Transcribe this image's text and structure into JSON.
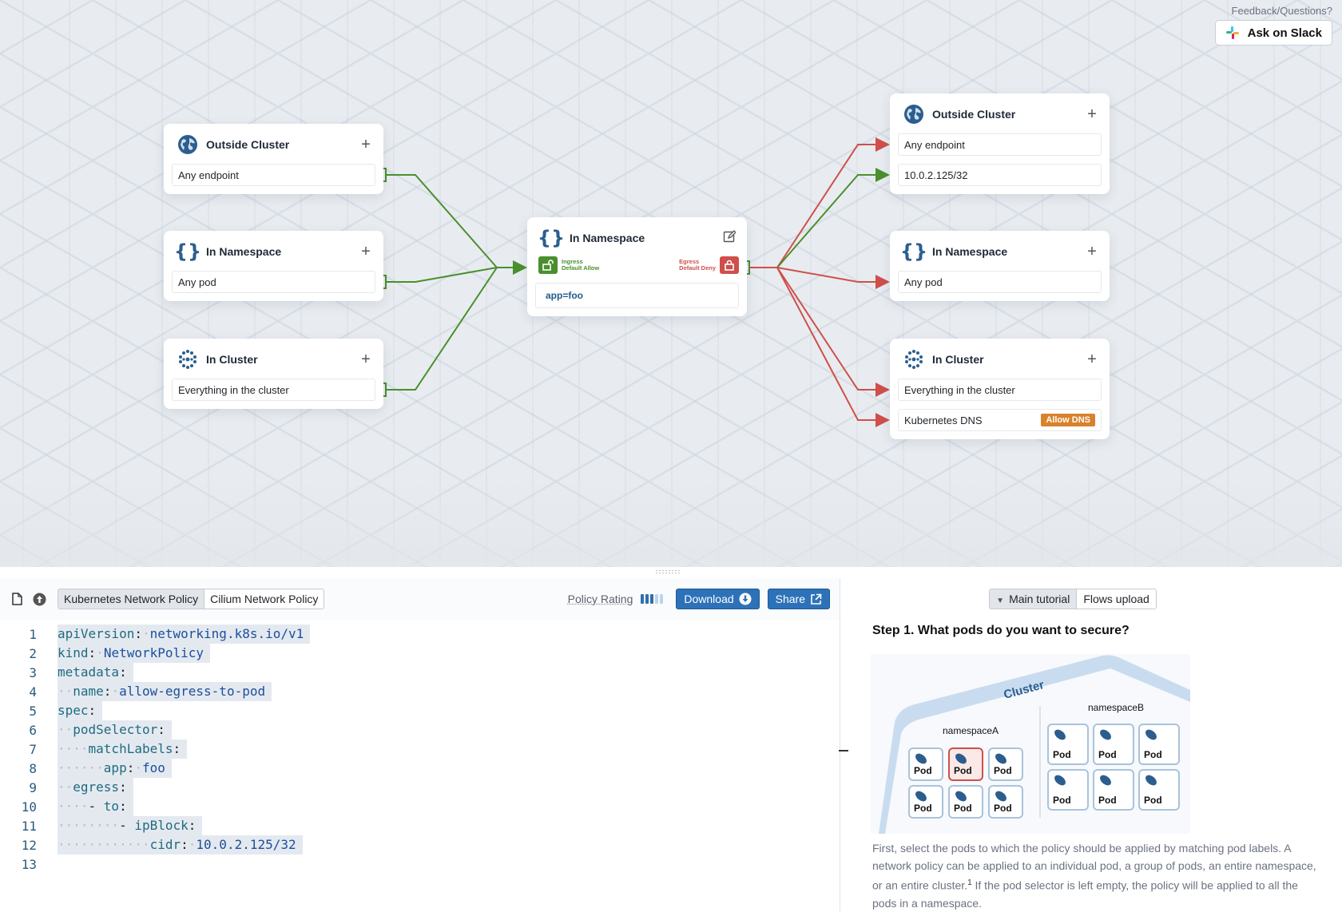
{
  "feedback": {
    "label": "Feedback/Questions?",
    "slack_button": "Ask on Slack"
  },
  "colors": {
    "allow": "#4a8f2e",
    "deny": "#cf4f4a",
    "brand": "#2d72b8",
    "dns_badge": "#d9822b"
  },
  "ingress": [
    {
      "title": "Outside Cluster",
      "icon": "globe-icon",
      "rows": [
        "Any endpoint"
      ]
    },
    {
      "title": "In Namespace",
      "icon": "braces-icon",
      "rows": [
        "Any pod"
      ]
    },
    {
      "title": "In Cluster",
      "icon": "cluster-icon",
      "rows": [
        "Everything in the cluster"
      ]
    }
  ],
  "center": {
    "title": "In Namespace",
    "ingress_label": "Ingress",
    "ingress_state": "Default Allow",
    "egress_label": "Egress",
    "egress_state": "Default Deny",
    "selector": "app=foo"
  },
  "egress": [
    {
      "title": "Outside Cluster",
      "icon": "globe-icon",
      "rows": [
        "Any endpoint",
        "10.0.2.125/32"
      ]
    },
    {
      "title": "In Namespace",
      "icon": "braces-icon",
      "rows": [
        "Any pod"
      ]
    },
    {
      "title": "In Cluster",
      "icon": "cluster-icon",
      "rows": [
        "Everything in the cluster",
        "Kubernetes DNS"
      ],
      "badge": "Allow DNS"
    }
  ],
  "editor": {
    "tabs": [
      "Kubernetes Network Policy",
      "Cilium Network Policy"
    ],
    "active_tab": 0,
    "rating_label": "Policy Rating",
    "rating": {
      "value": 3,
      "max": 5
    },
    "download": "Download",
    "share": "Share",
    "lines": [
      {
        "n": "1",
        "indent": 0,
        "key": "apiVersion",
        "val": "networking.k8s.io/v1"
      },
      {
        "n": "2",
        "indent": 0,
        "key": "kind",
        "val": "NetworkPolicy"
      },
      {
        "n": "3",
        "indent": 0,
        "key": "metadata",
        "val": ""
      },
      {
        "n": "4",
        "indent": 2,
        "key": "name",
        "val": "allow-egress-to-pod"
      },
      {
        "n": "5",
        "indent": 0,
        "key": "spec",
        "val": ""
      },
      {
        "n": "6",
        "indent": 2,
        "key": "podSelector",
        "val": ""
      },
      {
        "n": "7",
        "indent": 4,
        "key": "matchLabels",
        "val": ""
      },
      {
        "n": "8",
        "indent": 6,
        "key": "app",
        "val": "foo"
      },
      {
        "n": "9",
        "indent": 2,
        "key": "egress",
        "val": ""
      },
      {
        "n": "10",
        "indent": 4,
        "dash": true,
        "key": "to",
        "val": ""
      },
      {
        "n": "11",
        "indent": 8,
        "dash": true,
        "key": "ipBlock",
        "val": ""
      },
      {
        "n": "12",
        "indent": 12,
        "key": "cidr",
        "val": "10.0.2.125/32"
      },
      {
        "n": "13",
        "indent": 0,
        "key": "",
        "val": ""
      }
    ]
  },
  "tutorial": {
    "tabs": [
      "Main tutorial",
      "Flows upload"
    ],
    "active_tab": 0,
    "step_title": "Step 1. What pods do you want to secure?",
    "illustration": {
      "cluster_label": "Cluster",
      "namespace_a": "namespaceA",
      "namespace_b": "namespaceB",
      "pod_label": "Pod",
      "selected_pod": "namespaceA pod 2"
    },
    "body_1": "First, select the pods to which the policy should be applied by matching pod labels. A network policy can be applied to an individual pod, a group of pods, an entire namespace, or an entire cluster.",
    "footnote": "1",
    "body_2": " If the pod selector is left empty, the policy will be applied to all the pods in a namespace."
  }
}
